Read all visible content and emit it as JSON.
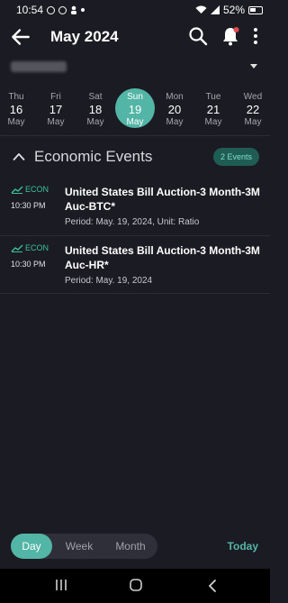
{
  "status_bar": {
    "time": "10:54",
    "battery": "52%"
  },
  "header": {
    "title": "May 2024"
  },
  "date_strip": [
    {
      "dow": "Thu",
      "day": "16",
      "month": "May",
      "selected": false
    },
    {
      "dow": "Fri",
      "day": "17",
      "month": "May",
      "selected": false
    },
    {
      "dow": "Sat",
      "day": "18",
      "month": "May",
      "selected": false
    },
    {
      "dow": "Sun",
      "day": "19",
      "month": "May",
      "selected": true
    },
    {
      "dow": "Mon",
      "day": "20",
      "month": "May",
      "selected": false
    },
    {
      "dow": "Tue",
      "day": "21",
      "month": "May",
      "selected": false
    },
    {
      "dow": "Wed",
      "day": "22",
      "month": "May",
      "selected": false
    }
  ],
  "section": {
    "title": "Economic Events",
    "badge": "2 Events"
  },
  "events": [
    {
      "tag": "ECON",
      "time": "10:30 PM",
      "title": "United States Bill Auction-3 Month-3M Auc-BTC*",
      "meta": "Period: May. 19, 2024, Unit: Ratio"
    },
    {
      "tag": "ECON",
      "time": "10:30 PM",
      "title": "United States Bill Auction-3 Month-3M Auc-HR*",
      "meta": "Period: May. 19, 2024"
    }
  ],
  "view_toggle": {
    "day": "Day",
    "week": "Week",
    "month": "Month",
    "selected": "Day"
  },
  "today_label": "Today",
  "colors": {
    "accent": "#53b5a5",
    "background": "#1b1b23",
    "econ_tag": "#3ac19c",
    "notification_dot": "#e5484d"
  }
}
